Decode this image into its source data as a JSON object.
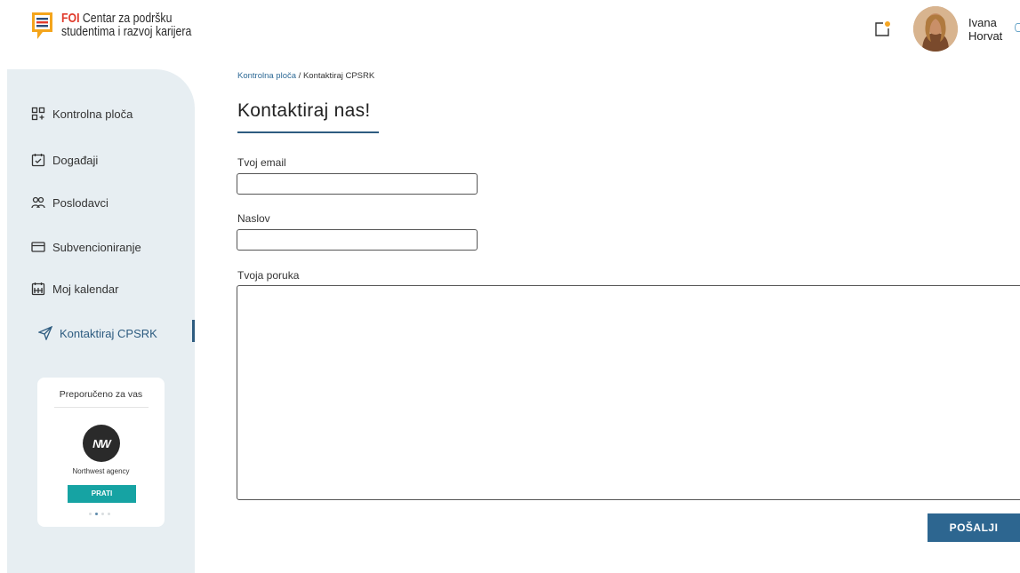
{
  "header": {
    "logo": {
      "brand": "FOI",
      "line1": "Centar za podršku",
      "line2": "studentima i razvoj karijera",
      "icon": "chat-bubble-list-icon"
    },
    "notification_icon": "notification-square-icon",
    "notification_dot_color": "#f5a623",
    "user": {
      "first_name": "Ivana",
      "last_name": "Horvat"
    }
  },
  "sidebar": {
    "items": [
      {
        "label": "Kontrolna ploča",
        "icon": "dashboard-grid-icon",
        "active": false
      },
      {
        "label": "Događaji",
        "icon": "calendar-check-icon",
        "active": false
      },
      {
        "label": "Poslodavci",
        "icon": "people-icon",
        "active": false
      },
      {
        "label": "Subvencioniranje",
        "icon": "credit-card-icon",
        "active": false
      },
      {
        "label": "Moj kalendar",
        "icon": "calendar-grid-icon",
        "active": false
      },
      {
        "label": "Kontaktiraj CPSRK",
        "icon": "send-icon",
        "active": true
      }
    ],
    "recommendation": {
      "title": "Preporučeno za vas",
      "company_logo_text": "NW",
      "company_name": "Northwest agency",
      "follow_label": "PRATI",
      "page_count": 4,
      "current_page": 2
    }
  },
  "breadcrumb": {
    "parent": "Kontrolna ploča",
    "separator": " / ",
    "current": "Kontaktiraj CPSRK"
  },
  "form": {
    "title": "Kontaktiraj nas!",
    "email_label": "Tvoj email",
    "email_value": "",
    "subject_label": "Naslov",
    "subject_value": "",
    "message_label": "Tvoja poruka",
    "message_value": "",
    "submit_label": "POŠALJI"
  },
  "colors": {
    "accent": "#2e5c80",
    "button": "#2d6690",
    "follow_button": "#16a3a3",
    "sidebar_bg": "#e7eef2",
    "brand_red": "#e03a2b"
  }
}
